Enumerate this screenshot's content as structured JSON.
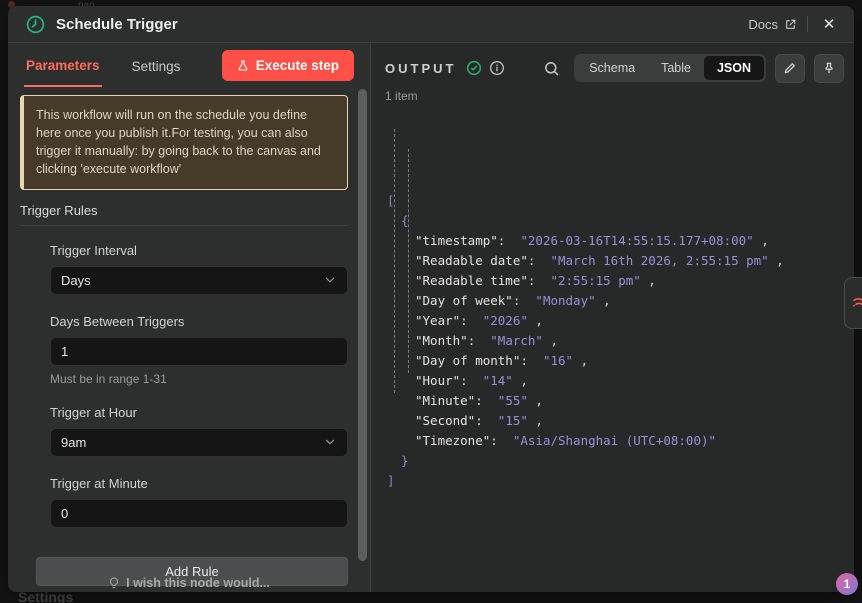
{
  "colors": {
    "primary": "#ff6d5a",
    "execute": "#ff4f46",
    "success": "#2bab67",
    "json_value": "#9a8ed8",
    "json_bracket": "#8f87c9",
    "notice_bg": "#463a28",
    "notice_border": "#e9d6ae"
  },
  "header": {
    "title": "Schedule Trigger",
    "docs_label": "Docs",
    "close_label": "✕"
  },
  "tabs": {
    "parameters": "Parameters",
    "settings": "Settings"
  },
  "execute_button_label": "Execute step",
  "notice_text": "This workflow will run on the schedule you define here once you publish it.For testing, you can also trigger it manually: by going back to the canvas and clicking 'execute workflow'",
  "section_title": "Trigger Rules",
  "fields": {
    "interval_label": "Trigger Interval",
    "interval_value": "Days",
    "days_between_label": "Days Between Triggers",
    "days_between_value": "1",
    "days_between_hint": "Must be in range 1-31",
    "hour_label": "Trigger at Hour",
    "hour_value": "9am",
    "minute_label": "Trigger at Minute",
    "minute_value": "0"
  },
  "add_rule_label": "Add Rule",
  "wish_text": "I wish this node would...",
  "output": {
    "title": "OUTPUT",
    "items_count": "1 item",
    "view_tabs": [
      "Schema",
      "Table",
      "JSON"
    ],
    "active_view_tab": "JSON",
    "json_lines": [
      {
        "indent": 0,
        "bracket": "["
      },
      {
        "indent": 1,
        "bracket": "{"
      },
      {
        "indent": 2,
        "key": "timestamp",
        "value": "2026-03-16T14:55:15.177+08:00",
        "comma": true
      },
      {
        "indent": 2,
        "key": "Readable date",
        "value": "March 16th 2026, 2:55:15 pm",
        "comma": true
      },
      {
        "indent": 2,
        "key": "Readable time",
        "value": "2:55:15 pm",
        "comma": true
      },
      {
        "indent": 2,
        "key": "Day of week",
        "value": "Monday",
        "comma": true
      },
      {
        "indent": 2,
        "key": "Year",
        "value": "2026",
        "comma": true
      },
      {
        "indent": 2,
        "key": "Month",
        "value": "March",
        "comma": true
      },
      {
        "indent": 2,
        "key": "Day of month",
        "value": "16",
        "comma": true
      },
      {
        "indent": 2,
        "key": "Hour",
        "value": "14",
        "comma": true
      },
      {
        "indent": 2,
        "key": "Minute",
        "value": "55",
        "comma": true
      },
      {
        "indent": 2,
        "key": "Second",
        "value": "15",
        "comma": true
      },
      {
        "indent": 2,
        "key": "Timezone",
        "value": "Asia/Shanghai (UTC+08:00)",
        "comma": false
      },
      {
        "indent": 1,
        "bracket": "}"
      },
      {
        "indent": 0,
        "bracket": "]"
      }
    ]
  },
  "background": {
    "canvas_label": "nan",
    "settings_label": "Settings"
  },
  "notification_badge": "1"
}
